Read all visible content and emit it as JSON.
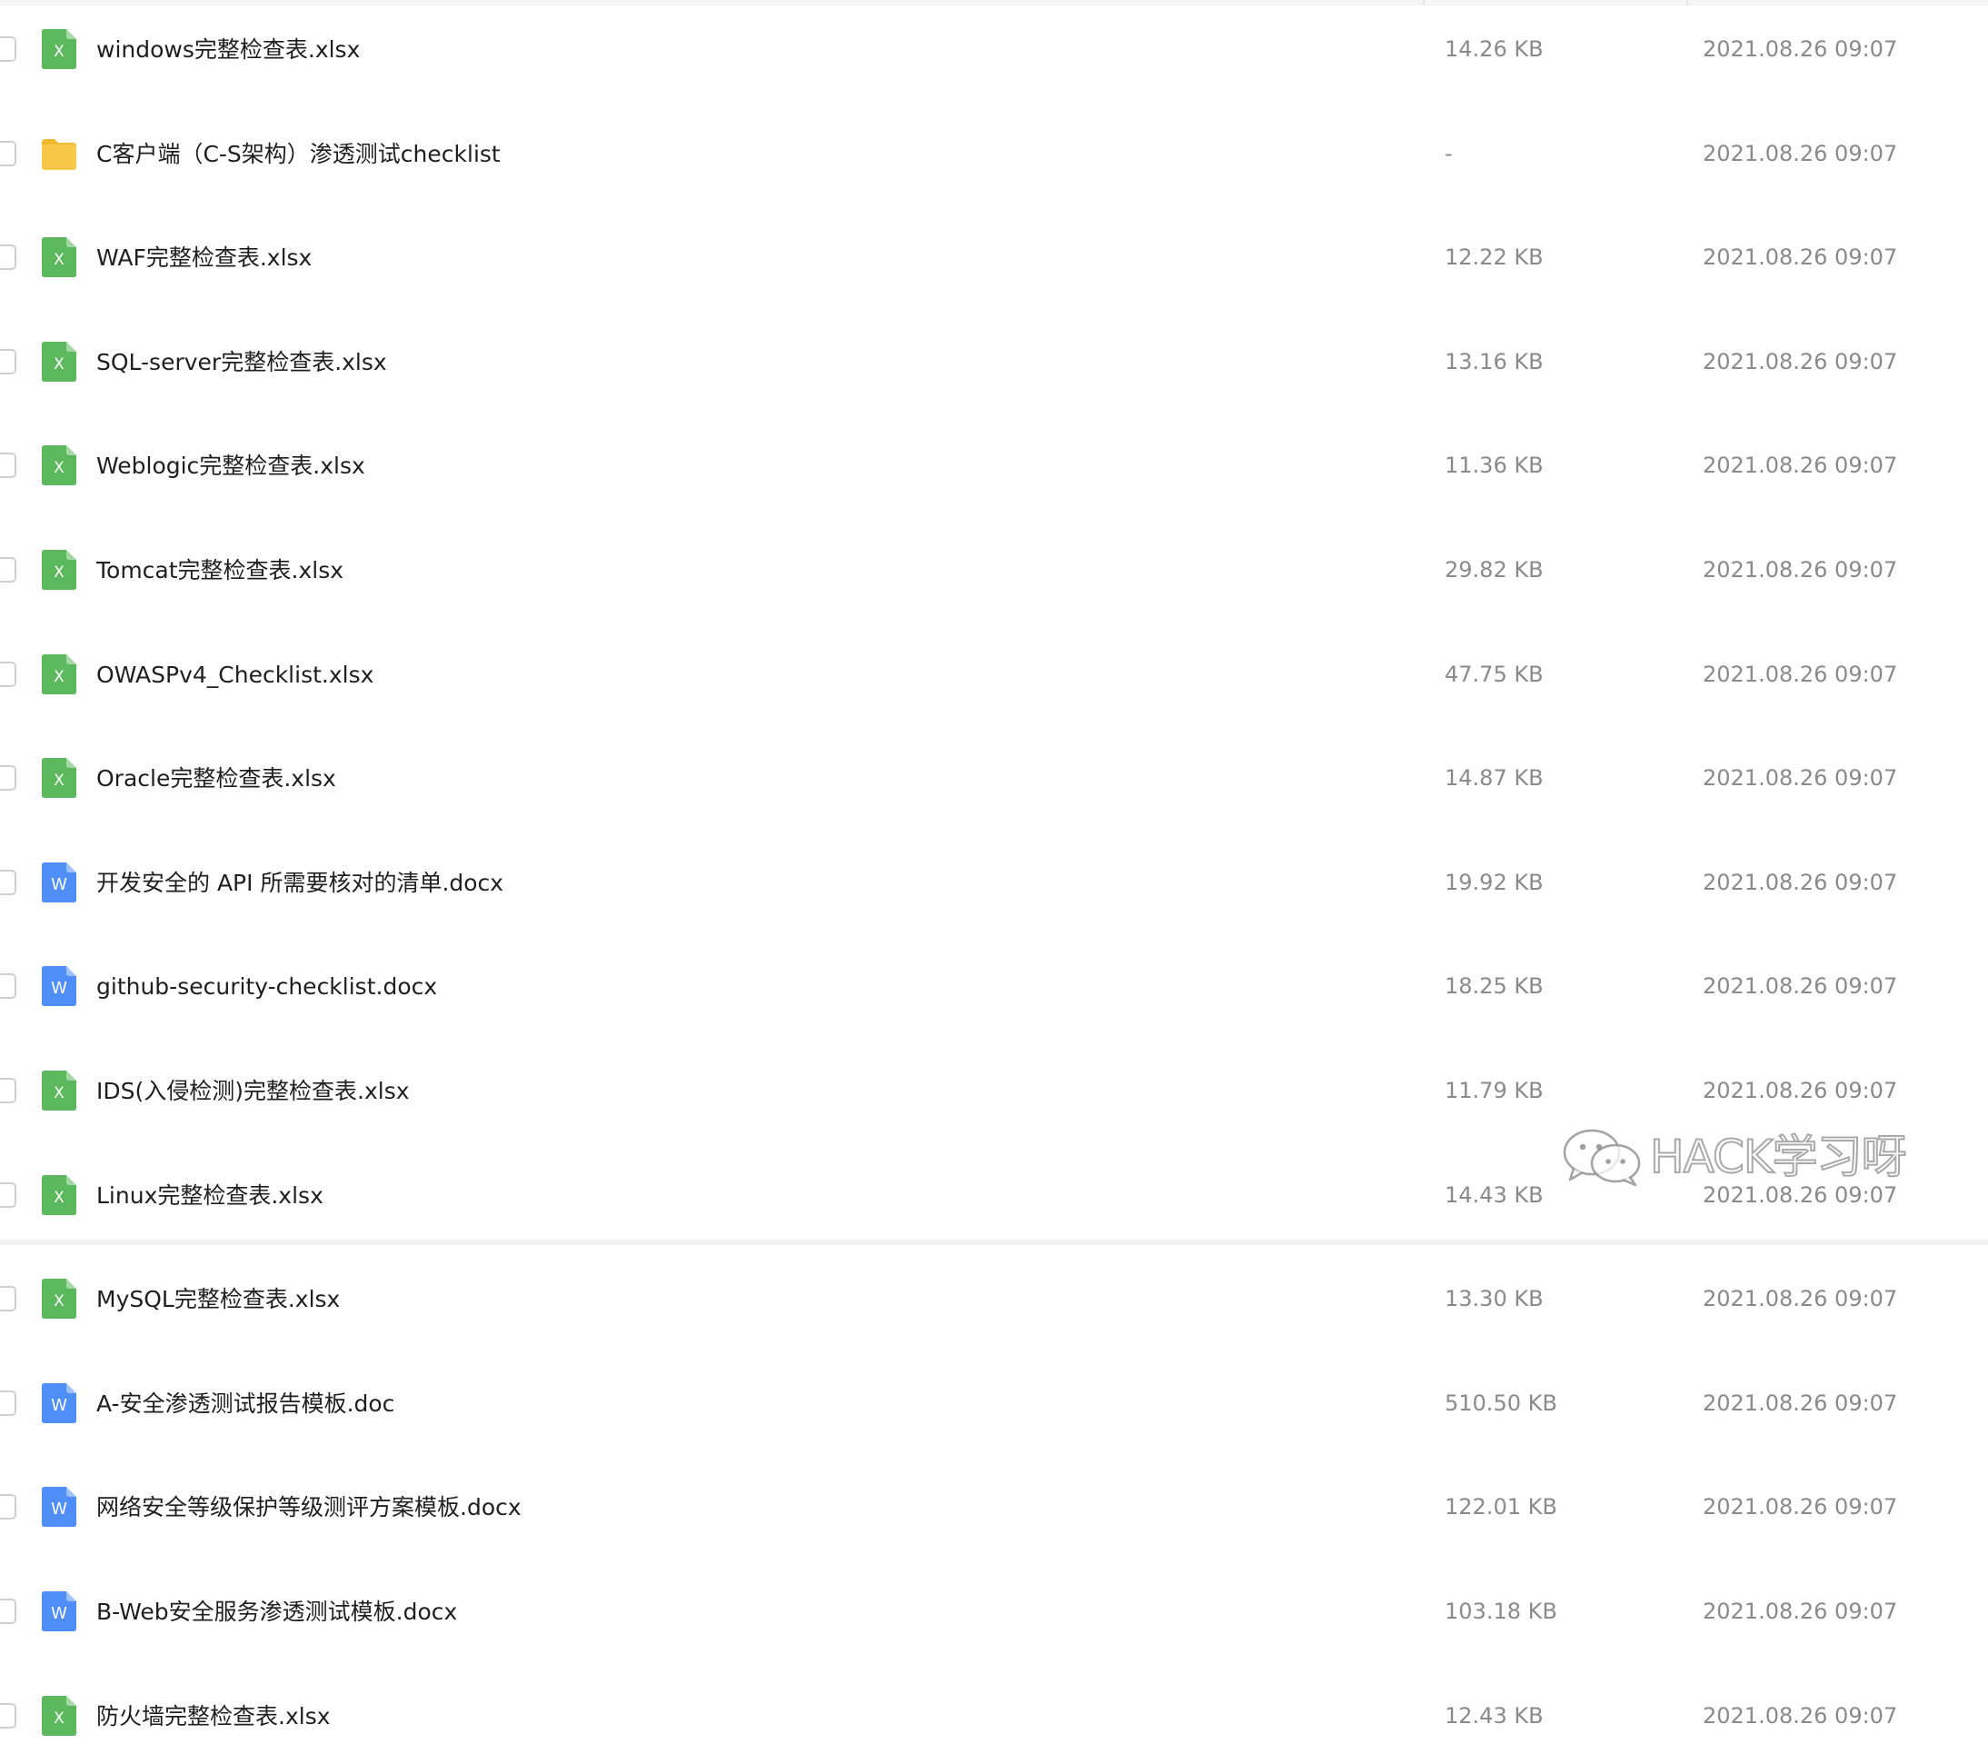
{
  "colors": {
    "excel_icon": "#5cb85c",
    "word_icon": "#4f8ef7",
    "folder_icon": "#f7c948",
    "name_text": "#1f1f1f",
    "meta_text": "#8a8a8a"
  },
  "files": [
    {
      "type": "excel",
      "icon": "excel-file-icon",
      "glyph": "X",
      "name": "windows完整检查表.xlsx",
      "size": "14.26 KB",
      "date": "2021.08.26 09:07"
    },
    {
      "type": "folder",
      "icon": "folder-icon",
      "glyph": "",
      "name": "C客户端（C-S架构）渗透测试checklist",
      "size": "-",
      "date": "2021.08.26 09:07"
    },
    {
      "type": "excel",
      "icon": "excel-file-icon",
      "glyph": "X",
      "name": "WAF完整检查表.xlsx",
      "size": "12.22 KB",
      "date": "2021.08.26 09:07"
    },
    {
      "type": "excel",
      "icon": "excel-file-icon",
      "glyph": "X",
      "name": "SQL-server完整检查表.xlsx",
      "size": "13.16 KB",
      "date": "2021.08.26 09:07"
    },
    {
      "type": "excel",
      "icon": "excel-file-icon",
      "glyph": "X",
      "name": "Weblogic完整检查表.xlsx",
      "size": "11.36 KB",
      "date": "2021.08.26 09:07"
    },
    {
      "type": "excel",
      "icon": "excel-file-icon",
      "glyph": "X",
      "name": "Tomcat完整检查表.xlsx",
      "size": "29.82 KB",
      "date": "2021.08.26 09:07"
    },
    {
      "type": "excel",
      "icon": "excel-file-icon",
      "glyph": "X",
      "name": "OWASPv4_Checklist.xlsx",
      "size": "47.75 KB",
      "date": "2021.08.26 09:07"
    },
    {
      "type": "excel",
      "icon": "excel-file-icon",
      "glyph": "X",
      "name": "Oracle完整检查表.xlsx",
      "size": "14.87 KB",
      "date": "2021.08.26 09:07"
    },
    {
      "type": "word",
      "icon": "word-file-icon",
      "glyph": "W",
      "name": "开发安全的 API 所需要核对的清单.docx",
      "size": "19.92 KB",
      "date": "2021.08.26 09:07"
    },
    {
      "type": "word",
      "icon": "word-file-icon",
      "glyph": "W",
      "name": "github-security-checklist.docx",
      "size": "18.25 KB",
      "date": "2021.08.26 09:07"
    },
    {
      "type": "excel",
      "icon": "excel-file-icon",
      "glyph": "X",
      "name": "IDS(入侵检测)完整检查表.xlsx",
      "size": "11.79 KB",
      "date": "2021.08.26 09:07"
    },
    {
      "type": "excel",
      "icon": "excel-file-icon",
      "glyph": "X",
      "name": "Linux完整检查表.xlsx",
      "size": "14.43 KB",
      "date": "2021.08.26 09:07"
    },
    {
      "type": "excel",
      "icon": "excel-file-icon",
      "glyph": "X",
      "name": "MySQL完整检查表.xlsx",
      "size": "13.30 KB",
      "date": "2021.08.26 09:07"
    },
    {
      "type": "word",
      "icon": "word-file-icon",
      "glyph": "W",
      "name": "A-安全渗透测试报告模板.doc",
      "size": "510.50 KB",
      "date": "2021.08.26 09:07"
    },
    {
      "type": "word",
      "icon": "word-file-icon",
      "glyph": "W",
      "name": "网络安全等级保护等级测评方案模板.docx",
      "size": "122.01 KB",
      "date": "2021.08.26 09:07"
    },
    {
      "type": "word",
      "icon": "word-file-icon",
      "glyph": "W",
      "name": "B-Web安全服务渗透测试模板.docx",
      "size": "103.18 KB",
      "date": "2021.08.26 09:07"
    },
    {
      "type": "excel",
      "icon": "excel-file-icon",
      "glyph": "X",
      "name": "防火墙完整检查表.xlsx",
      "size": "12.43 KB",
      "date": "2021.08.26 09:07"
    }
  ],
  "watermark": {
    "icon": "wechat-icon",
    "text": "HACK学习呀"
  }
}
